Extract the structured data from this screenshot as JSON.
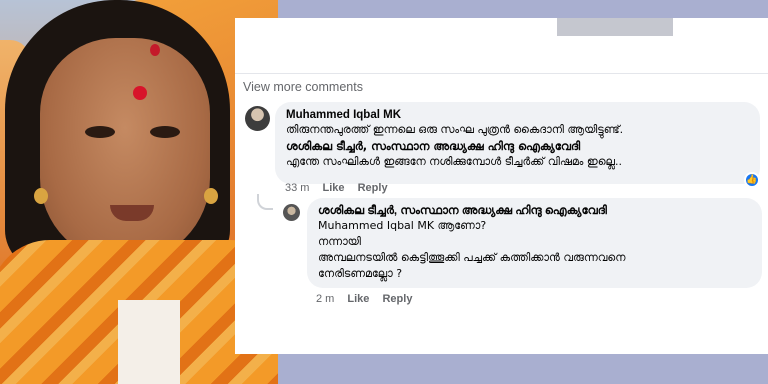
{
  "header": {
    "view_more": "View more comments"
  },
  "comments": [
    {
      "author": "Muhammed Iqbal MK",
      "lines": [
        "തിരുനന്തപുരത്ത് ഇന്നലെ ഒരു സംഘ പുത്രൻ കൈദാനി ആയിട്ടുണ്ട്.",
        "ശശികല ടീച്ചർ, സംസ്ഥാന അദ്ധ്യക്ഷ ഹിന്ദു ഐക്യവേദി",
        "എന്തേ സംഘികൾ ഇങ്ങനേ നശിക്കുമ്പോൾ ടീച്ചർക്ക് വിഷമം ഇല്ലെ.."
      ],
      "time": "33 m",
      "like": "Like",
      "reply": "Reply",
      "reaction_icon": "thumbs-up-icon"
    },
    {
      "author": "ശശികല ടീച്ചർ, സംസ്ഥാന അദ്ധ്യക്ഷ ഹിന്ദു ഐക്യവേദി",
      "lines": [
        "Muhammed Iqbal MK ആണോ?",
        "നന്നായി",
        "അമ്പലനടയിൽ കെട്ടിത്തൂക്കി പച്ചക്ക് കത്തിക്കാൻ വരുന്നവനെ",
        "നേരിടണമല്ലോ ?"
      ],
      "time": "2 m",
      "like": "Like",
      "reply": "Reply"
    }
  ],
  "colors": {
    "accent": "#1877f2",
    "bubble": "#f0f2f5",
    "background": "#a9afd0"
  }
}
